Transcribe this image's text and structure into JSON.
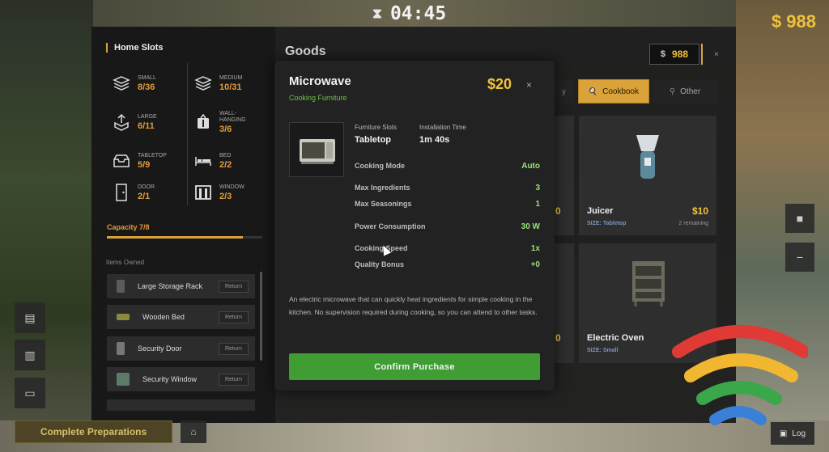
{
  "hud": {
    "timer": "04:45",
    "money": "$ 988"
  },
  "home_slots": {
    "title": "Home Slots",
    "slots": [
      {
        "label": "SMALL",
        "value": "8/36",
        "icon": "stack-layers-icon"
      },
      {
        "label": "MEDIUM",
        "value": "10/31",
        "icon": "stack-layers-icon"
      },
      {
        "label": "LARGE",
        "value": "6/11",
        "icon": "large-box-icon"
      },
      {
        "label": "WALL-\nHANGING",
        "value": "3/6",
        "icon": "wall-hanging-icon"
      },
      {
        "label": "TABLETOP",
        "value": "5/9",
        "icon": "tray-icon"
      },
      {
        "label": "BED",
        "value": "2/2",
        "icon": "bed-icon"
      },
      {
        "label": "DOOR",
        "value": "2/1",
        "icon": "door-icon"
      },
      {
        "label": "WINDOW",
        "value": "2/3",
        "icon": "window-icon"
      }
    ],
    "capacity_label": "Capacity 7/8",
    "capacity_fraction": 0.875,
    "items_owned_label": "Items Owned",
    "items": [
      {
        "name": "Large Storage Rack",
        "action": "Return"
      },
      {
        "name": "Wooden Bed",
        "action": "Return"
      },
      {
        "name": "Security Door",
        "action": "Return"
      },
      {
        "name": "Security Window",
        "action": "Return"
      }
    ]
  },
  "goods": {
    "title": "Goods",
    "money_currency": "$",
    "money_value": "988",
    "close": "×",
    "tabs": [
      {
        "label": "Cookbook",
        "active": true
      },
      {
        "label": "Other",
        "active": false
      }
    ],
    "cards": [
      {
        "name": "Juicer",
        "price": "$10",
        "size": "SIZE: Tabletop",
        "remaining": "2 remaining"
      },
      {
        "name": "Electric Oven",
        "price": "",
        "size": "SIZE: Small",
        "remaining": ""
      }
    ],
    "partial_prices": [
      "0",
      "0"
    ]
  },
  "modal": {
    "title": "Microwave",
    "subtitle": "Cooking Furniture",
    "price": "$20",
    "close": "×",
    "furniture_slots_label": "Furniture Slots",
    "furniture_slots_value": "Tabletop",
    "installation_time_label": "Installation Time",
    "installation_time_value": "1m 40s",
    "stats": [
      {
        "key": "Cooking Mode",
        "value": "Auto"
      },
      {
        "key": "Max Ingredients",
        "value": "3"
      },
      {
        "key": "Max Seasonings",
        "value": "1"
      },
      {
        "key": "Power Consumption",
        "value": "30 W"
      },
      {
        "key": "Cooking Speed",
        "value": "1x"
      },
      {
        "key": "Quality Bonus",
        "value": "+0"
      }
    ],
    "description": "An electric microwave that can quickly heat ingredients for simple cooking in the kitchen. No supervision required during cooking, so you can attend to other tasks.",
    "confirm_label": "Confirm Purchase"
  },
  "bottom": {
    "complete_label": "Complete Preparations",
    "log_label": "Log"
  },
  "colors": {
    "accent": "#d9a23a",
    "money": "#f0c23a",
    "positive": "#6cc24a",
    "confirm": "#3f9d33"
  }
}
